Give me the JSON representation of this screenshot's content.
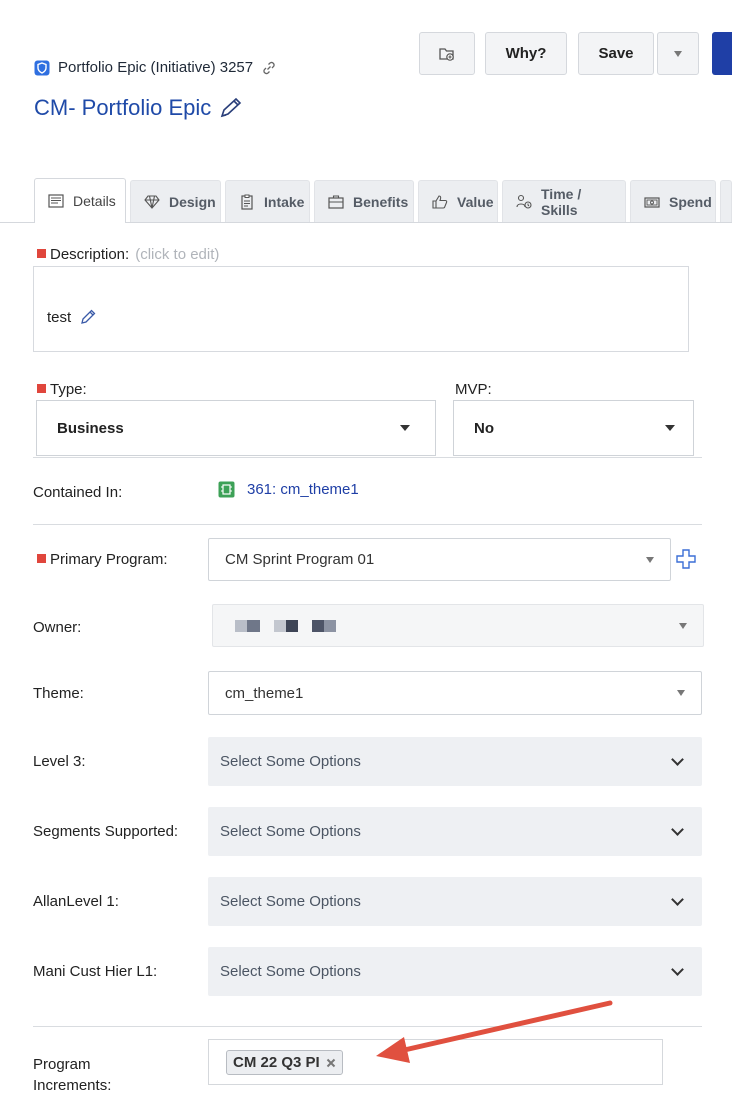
{
  "header": {
    "epic_type": "Portfolio Epic (Initiative) 3257",
    "title": "CM- Portfolio Epic",
    "buttons": {
      "why": "Why?",
      "save": "Save"
    },
    "icons": {
      "type": "shield-check-icon",
      "link": "link-icon",
      "edit": "pencil-icon",
      "folder": "folder-add-icon"
    },
    "colors": {
      "title": "#1f4aa8",
      "primary": "#1f3fa6"
    }
  },
  "tabs": [
    {
      "label": "Details",
      "icon": "document-icon",
      "active": true
    },
    {
      "label": "Design",
      "icon": "diamond-icon"
    },
    {
      "label": "Intake",
      "icon": "clipboard-icon"
    },
    {
      "label": "Benefits",
      "icon": "briefcase-icon"
    },
    {
      "label": "Value",
      "icon": "thumbs-up-icon"
    },
    {
      "label": "Time / Skills",
      "icon": "people-icon"
    },
    {
      "label": "Spend",
      "icon": "money-icon"
    }
  ],
  "description": {
    "label": "Description:",
    "hint": "(click to edit)",
    "value": "test"
  },
  "type": {
    "label": "Type:",
    "value": "Business"
  },
  "mvp": {
    "label": "MVP:",
    "value": "No"
  },
  "contained_in": {
    "label": "Contained In:",
    "value": "361: cm_theme1"
  },
  "primary_program": {
    "label": "Primary Program:",
    "value": "CM Sprint Program 01"
  },
  "owner": {
    "label": "Owner:"
  },
  "theme": {
    "label": "Theme:",
    "value": "cm_theme1"
  },
  "multi_fields": [
    {
      "label": "Level 3:",
      "placeholder": "Select Some Options"
    },
    {
      "label": "Segments Supported:",
      "placeholder": "Select Some Options"
    },
    {
      "label": "AllanLevel 1:",
      "placeholder": "Select Some Options"
    },
    {
      "label": "Mani Cust Hier L1:",
      "placeholder": "Select Some Options"
    }
  ],
  "program_increments": {
    "label": "Program Increments:",
    "tokens": [
      "CM 22 Q3 PI"
    ]
  },
  "annotation": {
    "color": "#e0503f"
  }
}
